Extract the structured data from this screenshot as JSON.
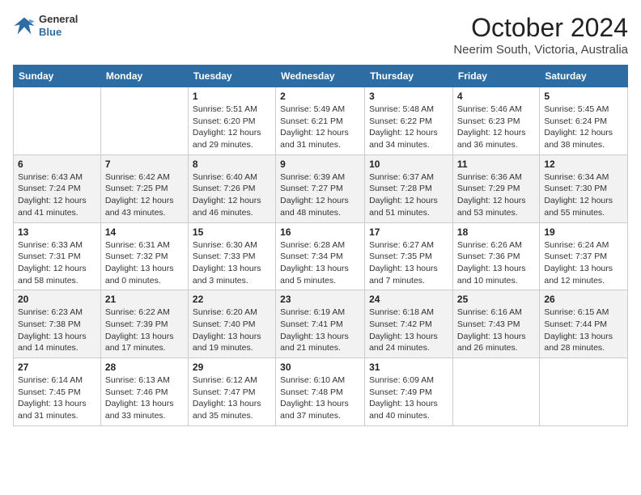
{
  "header": {
    "logo_general": "General",
    "logo_blue": "Blue",
    "title": "October 2024",
    "subtitle": "Neerim South, Victoria, Australia"
  },
  "days_of_week": [
    "Sunday",
    "Monday",
    "Tuesday",
    "Wednesday",
    "Thursday",
    "Friday",
    "Saturday"
  ],
  "weeks": [
    [
      {
        "num": "",
        "info": ""
      },
      {
        "num": "",
        "info": ""
      },
      {
        "num": "1",
        "info": "Sunrise: 5:51 AM\nSunset: 6:20 PM\nDaylight: 12 hours and 29 minutes."
      },
      {
        "num": "2",
        "info": "Sunrise: 5:49 AM\nSunset: 6:21 PM\nDaylight: 12 hours and 31 minutes."
      },
      {
        "num": "3",
        "info": "Sunrise: 5:48 AM\nSunset: 6:22 PM\nDaylight: 12 hours and 34 minutes."
      },
      {
        "num": "4",
        "info": "Sunrise: 5:46 AM\nSunset: 6:23 PM\nDaylight: 12 hours and 36 minutes."
      },
      {
        "num": "5",
        "info": "Sunrise: 5:45 AM\nSunset: 6:24 PM\nDaylight: 12 hours and 38 minutes."
      }
    ],
    [
      {
        "num": "6",
        "info": "Sunrise: 6:43 AM\nSunset: 7:24 PM\nDaylight: 12 hours and 41 minutes."
      },
      {
        "num": "7",
        "info": "Sunrise: 6:42 AM\nSunset: 7:25 PM\nDaylight: 12 hours and 43 minutes."
      },
      {
        "num": "8",
        "info": "Sunrise: 6:40 AM\nSunset: 7:26 PM\nDaylight: 12 hours and 46 minutes."
      },
      {
        "num": "9",
        "info": "Sunrise: 6:39 AM\nSunset: 7:27 PM\nDaylight: 12 hours and 48 minutes."
      },
      {
        "num": "10",
        "info": "Sunrise: 6:37 AM\nSunset: 7:28 PM\nDaylight: 12 hours and 51 minutes."
      },
      {
        "num": "11",
        "info": "Sunrise: 6:36 AM\nSunset: 7:29 PM\nDaylight: 12 hours and 53 minutes."
      },
      {
        "num": "12",
        "info": "Sunrise: 6:34 AM\nSunset: 7:30 PM\nDaylight: 12 hours and 55 minutes."
      }
    ],
    [
      {
        "num": "13",
        "info": "Sunrise: 6:33 AM\nSunset: 7:31 PM\nDaylight: 12 hours and 58 minutes."
      },
      {
        "num": "14",
        "info": "Sunrise: 6:31 AM\nSunset: 7:32 PM\nDaylight: 13 hours and 0 minutes."
      },
      {
        "num": "15",
        "info": "Sunrise: 6:30 AM\nSunset: 7:33 PM\nDaylight: 13 hours and 3 minutes."
      },
      {
        "num": "16",
        "info": "Sunrise: 6:28 AM\nSunset: 7:34 PM\nDaylight: 13 hours and 5 minutes."
      },
      {
        "num": "17",
        "info": "Sunrise: 6:27 AM\nSunset: 7:35 PM\nDaylight: 13 hours and 7 minutes."
      },
      {
        "num": "18",
        "info": "Sunrise: 6:26 AM\nSunset: 7:36 PM\nDaylight: 13 hours and 10 minutes."
      },
      {
        "num": "19",
        "info": "Sunrise: 6:24 AM\nSunset: 7:37 PM\nDaylight: 13 hours and 12 minutes."
      }
    ],
    [
      {
        "num": "20",
        "info": "Sunrise: 6:23 AM\nSunset: 7:38 PM\nDaylight: 13 hours and 14 minutes."
      },
      {
        "num": "21",
        "info": "Sunrise: 6:22 AM\nSunset: 7:39 PM\nDaylight: 13 hours and 17 minutes."
      },
      {
        "num": "22",
        "info": "Sunrise: 6:20 AM\nSunset: 7:40 PM\nDaylight: 13 hours and 19 minutes."
      },
      {
        "num": "23",
        "info": "Sunrise: 6:19 AM\nSunset: 7:41 PM\nDaylight: 13 hours and 21 minutes."
      },
      {
        "num": "24",
        "info": "Sunrise: 6:18 AM\nSunset: 7:42 PM\nDaylight: 13 hours and 24 minutes."
      },
      {
        "num": "25",
        "info": "Sunrise: 6:16 AM\nSunset: 7:43 PM\nDaylight: 13 hours and 26 minutes."
      },
      {
        "num": "26",
        "info": "Sunrise: 6:15 AM\nSunset: 7:44 PM\nDaylight: 13 hours and 28 minutes."
      }
    ],
    [
      {
        "num": "27",
        "info": "Sunrise: 6:14 AM\nSunset: 7:45 PM\nDaylight: 13 hours and 31 minutes."
      },
      {
        "num": "28",
        "info": "Sunrise: 6:13 AM\nSunset: 7:46 PM\nDaylight: 13 hours and 33 minutes."
      },
      {
        "num": "29",
        "info": "Sunrise: 6:12 AM\nSunset: 7:47 PM\nDaylight: 13 hours and 35 minutes."
      },
      {
        "num": "30",
        "info": "Sunrise: 6:10 AM\nSunset: 7:48 PM\nDaylight: 13 hours and 37 minutes."
      },
      {
        "num": "31",
        "info": "Sunrise: 6:09 AM\nSunset: 7:49 PM\nDaylight: 13 hours and 40 minutes."
      },
      {
        "num": "",
        "info": ""
      },
      {
        "num": "",
        "info": ""
      }
    ]
  ]
}
